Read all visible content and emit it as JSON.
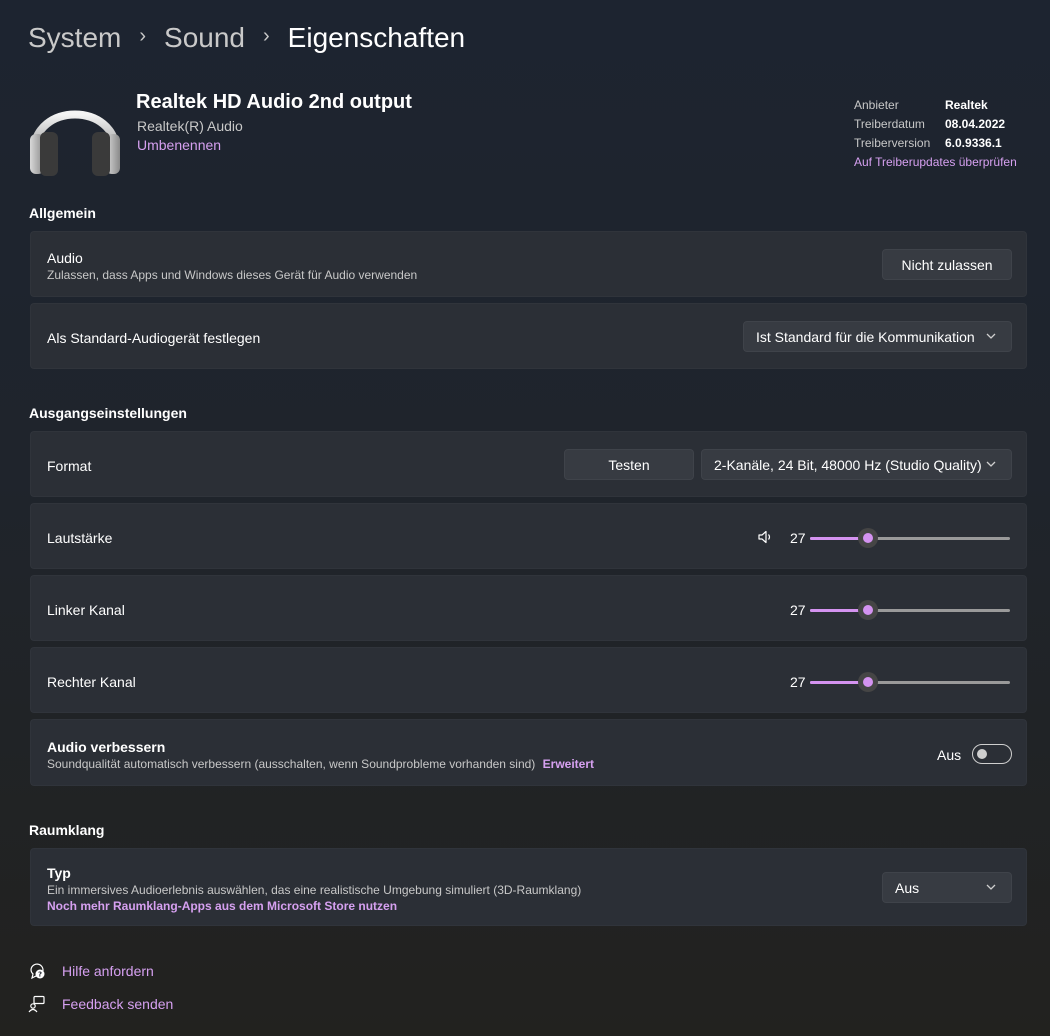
{
  "breadcrumb": {
    "level1": "System",
    "level2": "Sound",
    "current": "Eigenschaften"
  },
  "device": {
    "name": "Realtek HD Audio 2nd output",
    "subtitle": "Realtek(R) Audio",
    "rename_link": "Umbenennen",
    "icon": "headphones-icon"
  },
  "driver_info": {
    "vendor_label": "Anbieter",
    "vendor_value": "Realtek",
    "date_label": "Treiberdatum",
    "date_value": "08.04.2022",
    "version_label": "Treiberversion",
    "version_value": "6.0.9336.1",
    "update_link": "Auf Treiberupdates überprüfen"
  },
  "general": {
    "title": "Allgemein",
    "audio_label": "Audio",
    "audio_desc": "Zulassen, dass Apps und Windows dieses Gerät für Audio verwenden",
    "audio_button": "Nicht zulassen",
    "default_label": "Als Standard-Audiogerät festlegen",
    "default_value": "Ist Standard für die Kommunikation"
  },
  "output": {
    "title": "Ausgangseinstellungen",
    "format_label": "Format",
    "test_button": "Testen",
    "format_value": "2-Kanäle, 24 Bit, 48000 Hz (Studio Quality)",
    "volume_label": "Lautstärke",
    "volume_value": "27",
    "left_label": "Linker Kanal",
    "left_value": "27",
    "right_label": "Rechter Kanal",
    "right_value": "27",
    "slider_fraction": 0.29,
    "enhance_label": "Audio verbessern",
    "enhance_desc": "Soundqualität automatisch verbessern (ausschalten, wenn Soundprobleme vorhanden sind)",
    "enhance_link": "Erweitert",
    "enhance_state": "Aus"
  },
  "spatial": {
    "title": "Raumklang",
    "type_label": "Typ",
    "type_desc": "Ein immersives Audioerlebnis auswählen, das eine realistische Umgebung simuliert (3D-Raumklang)",
    "store_link": "Noch mehr Raumklang-Apps aus dem Microsoft Store nutzen",
    "type_value": "Aus"
  },
  "footer": {
    "help": "Hilfe anfordern",
    "feedback": "Feedback senden"
  },
  "colors": {
    "accent": "#d493f0",
    "link": "#d6a0f0",
    "card": "#2b2f36"
  }
}
